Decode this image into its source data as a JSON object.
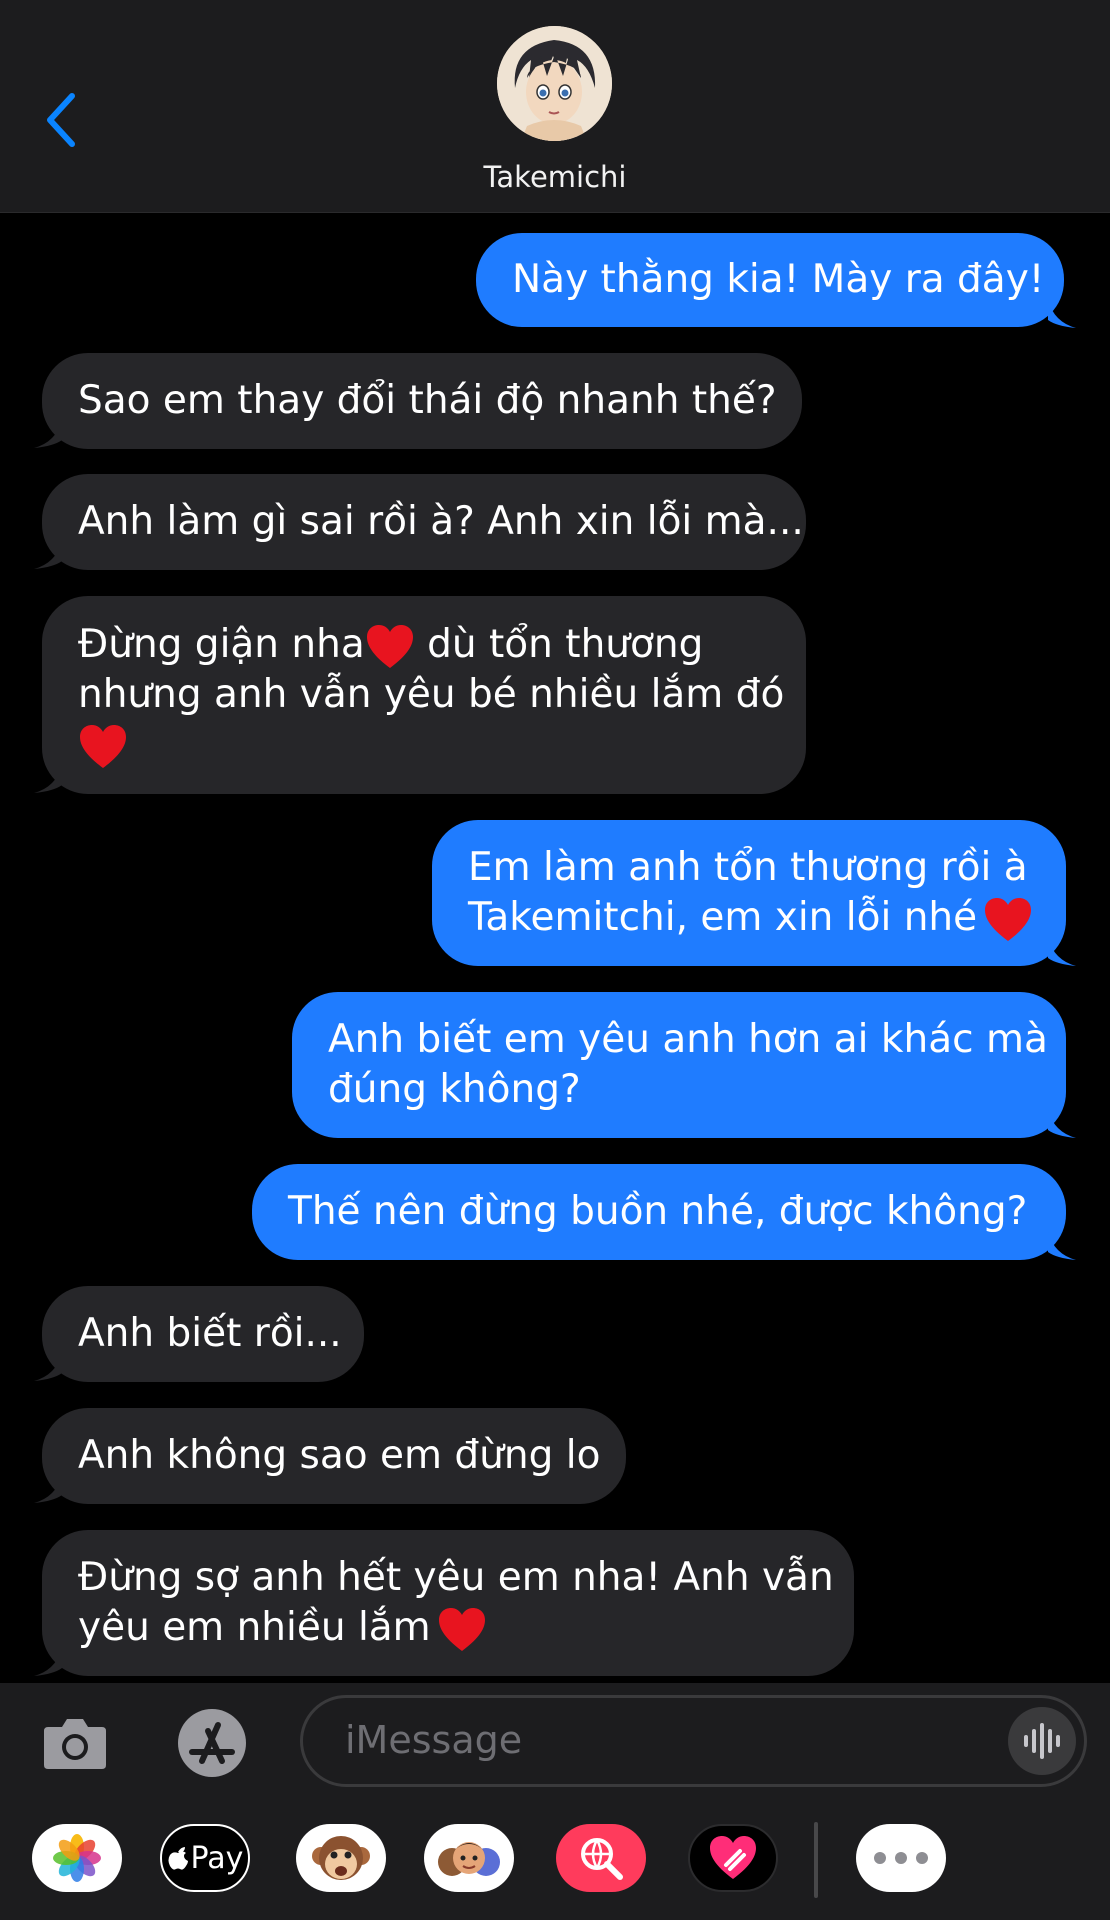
{
  "header": {
    "contact_name": "Takemichi"
  },
  "messages": [
    {
      "dir": "out",
      "lines": [
        "Này thằng kia! Mày ra đây!"
      ]
    },
    {
      "dir": "in",
      "lines": [
        "Sao em thay đổi thái độ nhanh thế?"
      ]
    },
    {
      "dir": "in",
      "lines": [
        "Anh làm gì sai rồi à? Anh xin lỗi mà..."
      ]
    },
    {
      "dir": "in",
      "lines": [
        "Đừng giận nha",
        " dù tổn thương",
        "nhưng anh vẫn yêu bé nhiều lắm đó"
      ]
    },
    {
      "dir": "out",
      "lines": [
        "Em làm anh tổn thương rồi à",
        "Takemitchi, em xin lỗi nhé"
      ]
    },
    {
      "dir": "out",
      "lines": [
        "Anh biết em yêu anh hơn ai khác mà",
        "đúng không?"
      ]
    },
    {
      "dir": "out",
      "lines": [
        "Thế nên đừng buồn nhé, được không?"
      ]
    },
    {
      "dir": "in",
      "lines": [
        "Anh biết rồi..."
      ]
    },
    {
      "dir": "in",
      "lines": [
        "Anh không sao em đừng lo"
      ]
    },
    {
      "dir": "in",
      "lines": [
        "Đừng sợ anh hết yêu em nha! Anh vẫn",
        "yêu em nhiều lắm"
      ]
    }
  ],
  "compose": {
    "placeholder": "iMessage"
  },
  "drawer": {
    "apple_pay_label": "Pay"
  },
  "colors": {
    "outgoing": "#1f7cff",
    "incoming": "#262629",
    "accent": "#0a84ff",
    "header_bg": "#1c1c1e"
  }
}
